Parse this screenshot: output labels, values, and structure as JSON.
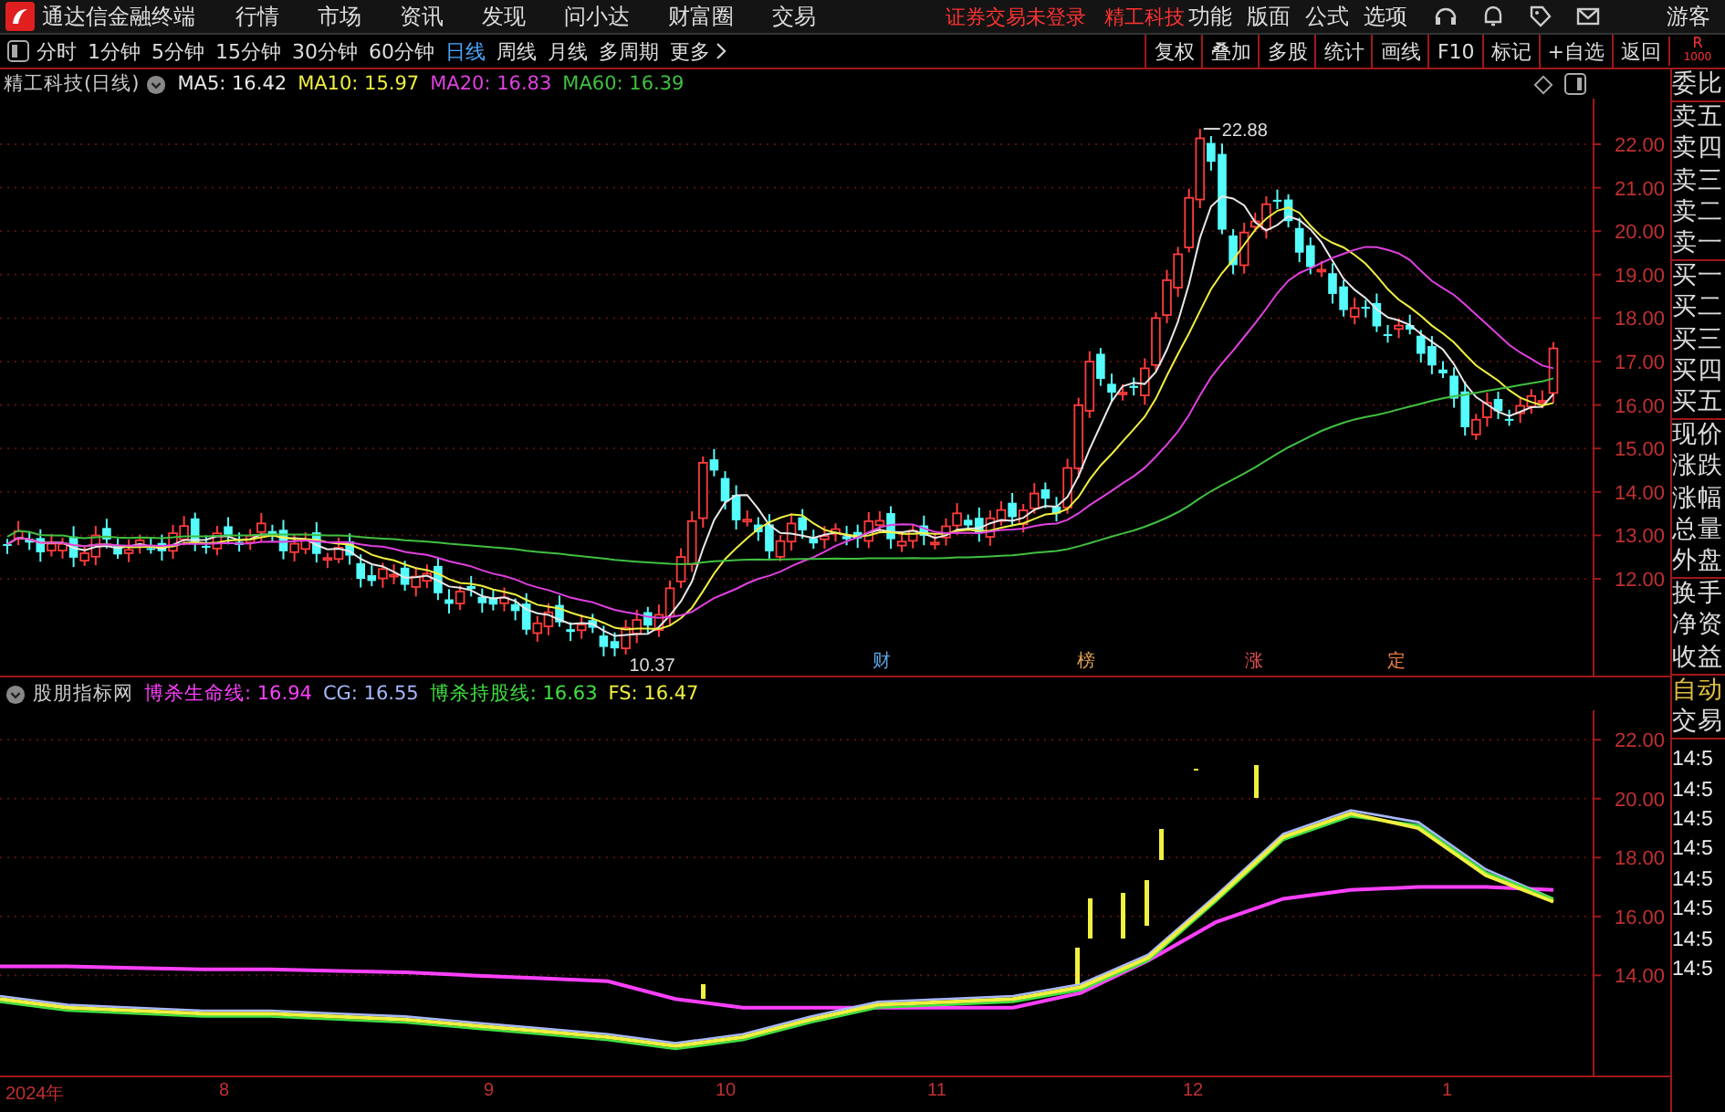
{
  "menu_bar": {
    "app_title": "通达信金融终端",
    "menus": [
      "行情",
      "市场",
      "资讯",
      "发现",
      "问小达",
      "财富圈",
      "交易"
    ],
    "notice": "证券交易未登录",
    "stock_name": "精工科技",
    "tools": [
      "功能",
      "版面",
      "公式",
      "选项"
    ],
    "user": "游客"
  },
  "period_bar": {
    "periods": [
      {
        "label": "分时",
        "selected": false
      },
      {
        "label": "1分钟",
        "selected": false
      },
      {
        "label": "5分钟",
        "selected": false
      },
      {
        "label": "15分钟",
        "selected": false
      },
      {
        "label": "30分钟",
        "selected": false
      },
      {
        "label": "60分钟",
        "selected": false
      },
      {
        "label": "日线",
        "selected": true
      },
      {
        "label": "周线",
        "selected": false
      },
      {
        "label": "月线",
        "selected": false
      },
      {
        "label": "多周期",
        "selected": false
      },
      {
        "label": "更多",
        "selected": false
      }
    ],
    "actions": [
      "复权",
      "叠加",
      "多股",
      "统计",
      "画线",
      "F10",
      "标记",
      "+自选",
      "返回"
    ],
    "corner_label": "R",
    "corner_value": "1000"
  },
  "main_chart": {
    "title": "精工科技(日线)",
    "ma": [
      {
        "label": "MA5: 16.42",
        "color": "#e8e8e8"
      },
      {
        "label": "MA10: 15.97",
        "color": "#f0f040"
      },
      {
        "label": "MA20: 16.83",
        "color": "#e040e0"
      },
      {
        "label": "MA60: 16.39",
        "color": "#40c040"
      }
    ],
    "price_ticks": [
      "22.00",
      "21.00",
      "20.00",
      "19.00",
      "18.00",
      "17.00",
      "16.00",
      "15.00",
      "14.00",
      "13.00",
      "12.00"
    ],
    "high_label": "22.88",
    "low_label": "10.37",
    "events": [
      {
        "text": "财",
        "color": "#5aa7e8"
      },
      {
        "text": "榜",
        "color": "#e0a050"
      },
      {
        "text": "涨",
        "color": "#e05050"
      },
      {
        "text": "定",
        "color": "#f08040"
      }
    ]
  },
  "quote_panel": {
    "groups": [
      {
        "labels": [
          "委比"
        ]
      },
      {
        "labels": [
          "卖五",
          "卖四",
          "卖三",
          "卖二",
          "卖一"
        ]
      },
      {
        "labels": [
          "买一",
          "买二",
          "买三",
          "买四",
          "买五"
        ]
      },
      {
        "labels": [
          "现价",
          "涨跌",
          "涨幅",
          "总量",
          "外盘"
        ]
      },
      {
        "labels": [
          "换手",
          "净资",
          "收益"
        ]
      }
    ]
  },
  "indicator": {
    "name": "股朋指标网",
    "lines": [
      {
        "value": ": 16.94"
      },
      {
        "value": ": 16.55"
      },
      {
        "value": ": 16.63"
      },
      {
        "value": ": 16.47"
      }
    ],
    "chart_data": {
      "type": "line",
      "ylim": [
        10.6,
        23
      ],
      "grid": true,
      "yticks": [
        {
          "value": 14,
          "label": "14.00"
        },
        {
          "value": 16,
          "label": "16.00"
        },
        {
          "value": 18,
          "label": "18.00"
        },
        {
          "value": 20,
          "label": "20.00"
        },
        {
          "value": 22,
          "label": "22.00"
        }
      ],
      "series": [
        {
          "name": "博杀生命线",
          "color": "#ff40ff",
          "values": [
            14.3,
            14.3,
            14.25,
            14.2,
            14.2,
            14.15,
            14.1,
            14.0,
            13.9,
            13.8,
            13.2,
            12.9,
            12.9,
            12.9,
            12.9,
            12.9,
            13.4,
            14.5,
            15.8,
            16.6,
            16.9,
            17.0,
            17.0,
            16.9
          ]
        },
        {
          "name": "CG",
          "color": "#a8b8ff",
          "values": [
            13.3,
            13.0,
            12.9,
            12.8,
            12.8,
            12.7,
            12.6,
            12.4,
            12.2,
            12.0,
            11.7,
            12.0,
            12.6,
            13.1,
            13.2,
            13.3,
            13.7,
            14.7,
            16.7,
            18.8,
            19.6,
            19.2,
            17.6,
            16.6
          ]
        },
        {
          "name": "博杀持股线",
          "color": "#40e040",
          "values": [
            13.1,
            12.8,
            12.7,
            12.6,
            12.6,
            12.5,
            12.4,
            12.2,
            12.0,
            11.8,
            11.5,
            11.8,
            12.4,
            12.9,
            13.0,
            13.1,
            13.5,
            14.5,
            16.5,
            18.6,
            19.4,
            19.1,
            17.5,
            16.6
          ]
        },
        {
          "name": "FS",
          "color": "#f0f040",
          "values": [
            13.2,
            12.9,
            12.8,
            12.7,
            12.7,
            12.6,
            12.5,
            12.3,
            12.1,
            11.9,
            11.6,
            11.9,
            12.5,
            13.0,
            13.1,
            13.2,
            13.6,
            14.6,
            16.6,
            18.7,
            19.5,
            19.0,
            17.4,
            16.5
          ]
        }
      ]
    }
  },
  "trade_panel": {
    "auto": "自动",
    "title": "交易",
    "times": [
      "14:5",
      "14:5",
      "14:5",
      "14:5",
      "14:5",
      "14:5",
      "14:5",
      "14:5"
    ]
  },
  "x_axis": {
    "labels": [
      "2024年",
      "8",
      "9",
      "10",
      "11",
      "12",
      "1"
    ]
  }
}
